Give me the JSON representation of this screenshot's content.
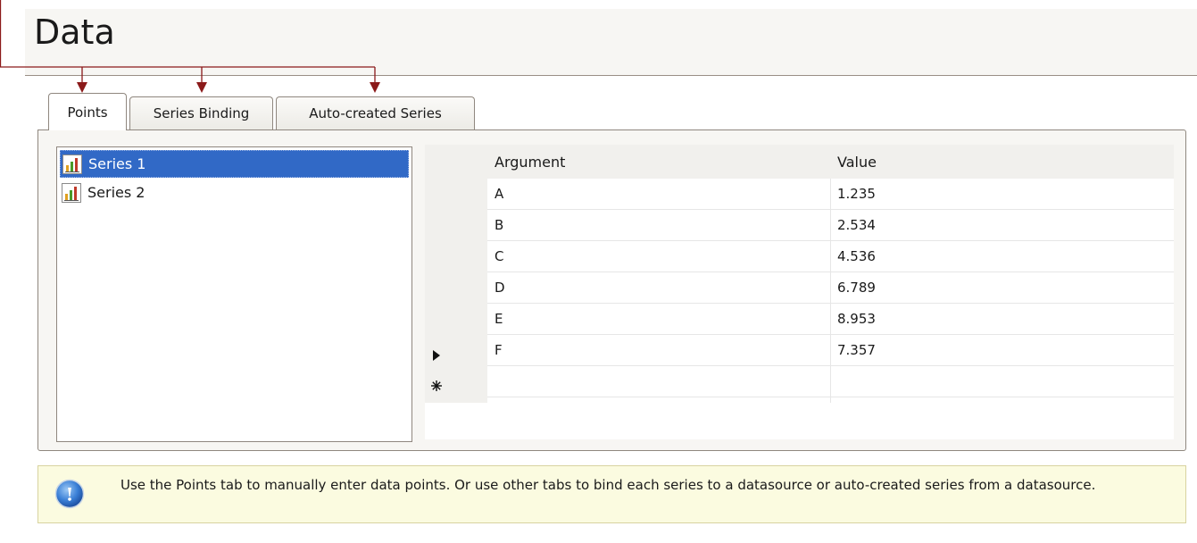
{
  "page": {
    "title": "Data"
  },
  "tabs": [
    {
      "label": "Points",
      "active": true
    },
    {
      "label": "Series Binding",
      "active": false
    },
    {
      "label": "Auto-created Series",
      "active": false
    }
  ],
  "series_list": {
    "items": [
      {
        "label": "Series 1",
        "icon": "bar-chart-icon",
        "selected": true
      },
      {
        "label": "Series 2",
        "icon": "bar-chart-icon",
        "selected": false
      }
    ]
  },
  "grid": {
    "columns": [
      "Argument",
      "Value"
    ],
    "rows": [
      {
        "argument": "A",
        "value": "1.235"
      },
      {
        "argument": "B",
        "value": "2.534"
      },
      {
        "argument": "C",
        "value": "4.536"
      },
      {
        "argument": "D",
        "value": "6.789"
      },
      {
        "argument": "E",
        "value": "8.953"
      },
      {
        "argument": "F",
        "value": "7.357"
      }
    ],
    "current_row_marker": "triangle-right-icon",
    "new_row_marker": "asterisk-icon"
  },
  "info": {
    "icon": "info-icon",
    "text": "Use the Points tab to manually enter data points. Or use other tabs to bind each series to a datasource or auto-created series from a datasource."
  },
  "colors": {
    "selection": "#3169c6",
    "annotation": "#8b1a1a",
    "info_background": "#fbfbe0"
  }
}
